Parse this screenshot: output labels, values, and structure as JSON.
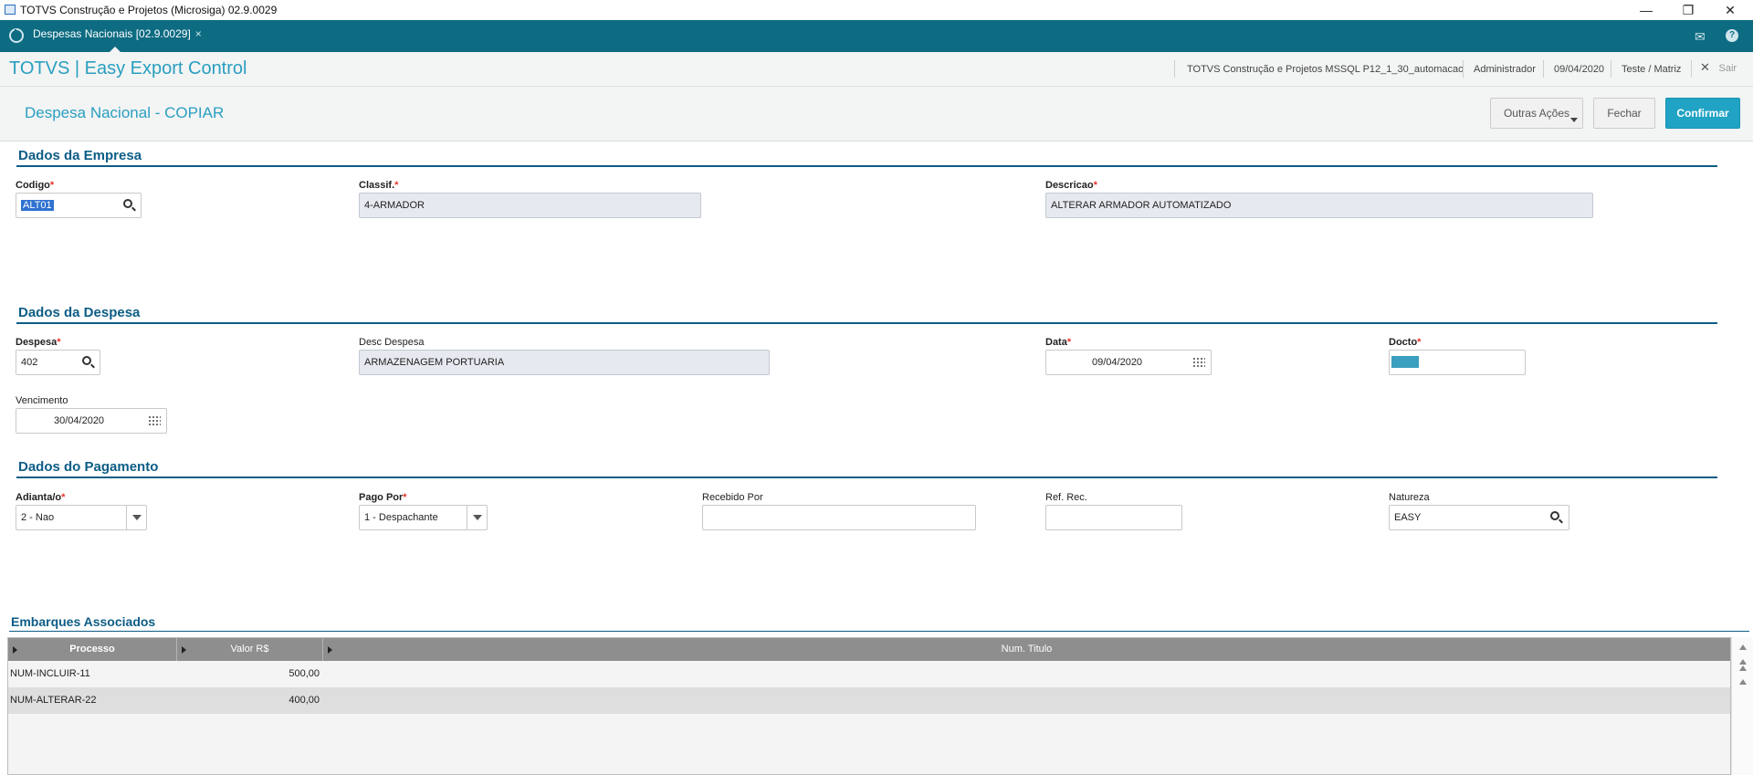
{
  "window": {
    "title": "TOTVS Construção e Projetos (Microsiga) 02.9.0029",
    "minimize": "—",
    "restore": "❐",
    "close": "✕"
  },
  "tabbar": {
    "tab_label": "Despesas Nacionais [02.9.0029]",
    "tab_close": "×",
    "mail_icon": "✉",
    "help_icon": "?"
  },
  "header": {
    "app_title": "TOTVS | Easy Export Control",
    "environment": "TOTVS Construção e Projetos MSSQL P12_1_30_automacao",
    "user": "Administrador",
    "date": "09/04/2020",
    "branch": "Teste / Matriz",
    "exit_icon": "✕",
    "exit_label": "Sair"
  },
  "page": {
    "title": "Despesa Nacional - COPIAR",
    "other_actions": "Outras Ações",
    "close": "Fechar",
    "confirm": "Confirmar"
  },
  "empresa": {
    "section": "Dados da Empresa",
    "codigo_label": "Codigo",
    "codigo_value": "ALT01",
    "classif_label": "Classif.",
    "classif_value": "4-ARMADOR",
    "descricao_label": "Descricao",
    "descricao_value": "ALTERAR ARMADOR AUTOMATIZADO"
  },
  "despesa": {
    "section": "Dados da Despesa",
    "despesa_label": "Despesa",
    "despesa_value": "402",
    "desc_label": "Desc Despesa",
    "desc_value": "ARMAZENAGEM PORTUARIA",
    "data_label": "Data",
    "data_value": "09/04/2020",
    "docto_label": "Docto",
    "vencimento_label": "Vencimento",
    "vencimento_value": "30/04/2020"
  },
  "pagamento": {
    "section": "Dados do Pagamento",
    "adiantado_label": "Adianta/o",
    "adiantado_value": "2 - Nao",
    "pago_por_label": "Pago Por",
    "pago_por_value": "1 - Despachante",
    "recebido_label": "Recebido Por",
    "recebido_value": "",
    "ref_label": "Ref. Rec.",
    "ref_value": "",
    "natureza_label": "Natureza",
    "natureza_value": "EASY"
  },
  "embarques": {
    "section": "Embarques Associados",
    "columns": [
      "Processo",
      "Valor R$",
      "Num. Titulo"
    ],
    "rows": [
      {
        "processo": "NUM-INCLUIR-11",
        "valor": "500,00",
        "titulo": ""
      },
      {
        "processo": "NUM-ALTERAR-22",
        "valor": "400,00",
        "titulo": ""
      }
    ]
  },
  "colors": {
    "tabbar": "#0d6b82",
    "accent": "#2a9fc0",
    "section": "#0d5d86",
    "primary_button": "#20a3c4",
    "required": "#e5352c"
  }
}
